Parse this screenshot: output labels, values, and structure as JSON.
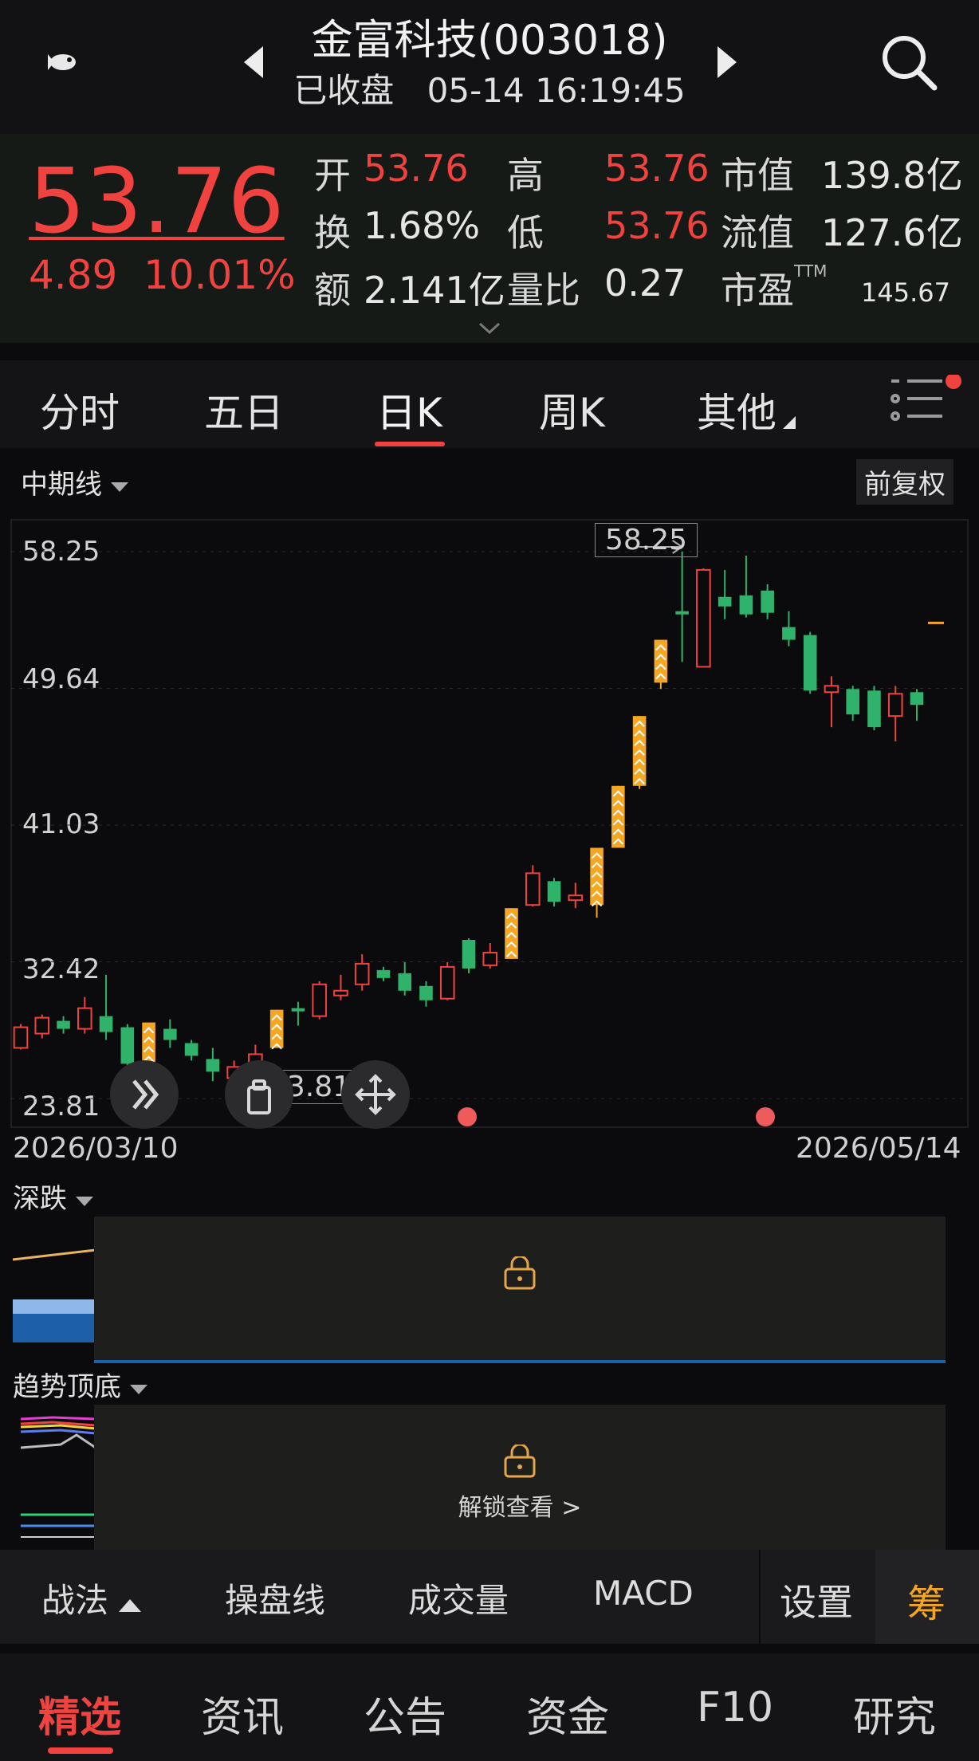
{
  "header": {
    "title": "金富科技(003018)",
    "status": "已收盘",
    "datetime": "05-14 16:19:45",
    "icons": [
      "fish-logo-icon",
      "prev-arrow-icon",
      "next-arrow-icon",
      "search-icon"
    ]
  },
  "quote": {
    "price": "53.76",
    "change": "4.89",
    "change_pct": "10.01%",
    "open_label": "开",
    "open": "53.76",
    "high_label": "高",
    "high": "53.76",
    "mktcap_label": "市值",
    "mktcap": "139.8亿",
    "turnover_label": "换",
    "turnover": "1.68%",
    "low_label": "低",
    "low": "53.76",
    "float_label": "流值",
    "float": "127.6亿",
    "amount_label": "额",
    "amount": "2.141亿",
    "volratio_label": "量比",
    "volratio": "0.27",
    "pe_label": "市盈",
    "pe_sup": "TTM",
    "pe": "145.67"
  },
  "tabs": [
    "分时",
    "五日",
    "日K",
    "周K",
    "其他"
  ],
  "active_tab": "日K",
  "chart_header": {
    "period": "中期线",
    "adjust": "前复权"
  },
  "chart_data": {
    "type": "candlestick",
    "x_start": "2026/03/10",
    "x_end": "2026/05/14",
    "y_ticks": [
      "58.25",
      "49.64",
      "41.03",
      "32.42",
      "23.81"
    ],
    "ylim": [
      23.81,
      58.25
    ],
    "max_label": "58.25",
    "min_label": "23.81",
    "up_color": "#f0433f",
    "down_color": "#2fb36a",
    "limit_up_color": "#f5a623",
    "candles": [
      {
        "o": 27.0,
        "c": 28.3,
        "h": 28.5,
        "l": 26.9
      },
      {
        "o": 27.9,
        "c": 28.9,
        "h": 29.1,
        "l": 27.6
      },
      {
        "o": 28.7,
        "c": 28.2,
        "h": 29.0,
        "l": 27.9
      },
      {
        "o": 28.2,
        "c": 29.5,
        "h": 30.2,
        "l": 27.9
      },
      {
        "o": 29.0,
        "c": 28.0,
        "h": 31.6,
        "l": 27.5
      },
      {
        "o": 28.3,
        "c": 26.0,
        "h": 28.5,
        "l": 25.4
      },
      {
        "o": 26.0,
        "c": 28.6,
        "h": 28.6,
        "l": 26.0,
        "lu": true
      },
      {
        "o": 28.2,
        "c": 27.5,
        "h": 28.8,
        "l": 27.0
      },
      {
        "o": 27.3,
        "c": 26.5,
        "h": 27.5,
        "l": 26.2
      },
      {
        "o": 26.3,
        "c": 25.5,
        "h": 27.0,
        "l": 24.9
      },
      {
        "o": 25.1,
        "c": 25.8,
        "h": 26.2,
        "l": 24.8
      },
      {
        "o": 25.9,
        "c": 26.6,
        "h": 27.2,
        "l": 25.5
      },
      {
        "o": 27.0,
        "c": 29.4,
        "h": 29.4,
        "l": 27.0,
        "lu": true
      },
      {
        "o": 29.5,
        "c": 29.3,
        "h": 29.9,
        "l": 28.4
      },
      {
        "o": 29.0,
        "c": 31.0,
        "h": 31.2,
        "l": 28.8
      },
      {
        "o": 30.3,
        "c": 30.6,
        "h": 31.6,
        "l": 30.0
      },
      {
        "o": 31.0,
        "c": 32.3,
        "h": 32.9,
        "l": 30.6
      },
      {
        "o": 31.9,
        "c": 31.4,
        "h": 32.1,
        "l": 31.2
      },
      {
        "o": 31.7,
        "c": 30.6,
        "h": 32.4,
        "l": 30.3
      },
      {
        "o": 30.9,
        "c": 30.0,
        "h": 31.2,
        "l": 29.6
      },
      {
        "o": 30.1,
        "c": 32.1,
        "h": 32.4,
        "l": 30.0
      },
      {
        "o": 33.8,
        "c": 32.0,
        "h": 33.9,
        "l": 31.7
      },
      {
        "o": 32.2,
        "c": 33.0,
        "h": 33.6,
        "l": 32.0
      },
      {
        "o": 32.6,
        "c": 35.8,
        "h": 35.8,
        "l": 32.6,
        "lu": true
      },
      {
        "o": 36.0,
        "c": 38.0,
        "h": 38.5,
        "l": 35.9
      },
      {
        "o": 37.5,
        "c": 36.2,
        "h": 37.7,
        "l": 35.9
      },
      {
        "o": 36.3,
        "c": 36.6,
        "h": 37.4,
        "l": 35.8
      },
      {
        "o": 36.0,
        "c": 39.6,
        "h": 39.6,
        "l": 35.2,
        "lu": true
      },
      {
        "o": 39.6,
        "c": 43.5,
        "h": 43.5,
        "l": 39.6,
        "lu": true
      },
      {
        "o": 43.5,
        "c": 47.9,
        "h": 47.9,
        "l": 43.3,
        "lu": true
      },
      {
        "o": 50.0,
        "c": 52.7,
        "h": 52.7,
        "l": 49.6,
        "lu": true
      },
      {
        "o": 54.5,
        "c": 54.3,
        "h": 58.25,
        "l": 51.3
      },
      {
        "o": 51.0,
        "c": 57.1,
        "h": 57.2,
        "l": 51.0
      },
      {
        "o": 55.4,
        "c": 54.8,
        "h": 57.1,
        "l": 54.0
      },
      {
        "o": 55.5,
        "c": 54.3,
        "h": 58.0,
        "l": 54.1
      },
      {
        "o": 55.8,
        "c": 54.4,
        "h": 56.2,
        "l": 54.0
      },
      {
        "o": 53.5,
        "c": 52.7,
        "h": 54.5,
        "l": 52.3
      },
      {
        "o": 53.0,
        "c": 49.5,
        "h": 53.2,
        "l": 49.3
      },
      {
        "o": 49.4,
        "c": 49.8,
        "h": 50.4,
        "l": 47.2
      },
      {
        "o": 49.6,
        "c": 48.0,
        "h": 49.8,
        "l": 47.6
      },
      {
        "o": 49.5,
        "c": 47.2,
        "h": 49.8,
        "l": 47.0
      },
      {
        "o": 47.9,
        "c": 49.3,
        "h": 49.8,
        "l": 46.3
      },
      {
        "o": 49.4,
        "c": 48.6,
        "h": 49.6,
        "l": 47.6
      }
    ]
  },
  "sub_panels": [
    {
      "title": "深跌"
    },
    {
      "title": "趋势顶底",
      "unlock": "解锁查看 >"
    }
  ],
  "strategy_bar": {
    "items": [
      "战法",
      "操盘线",
      "成交量",
      "MACD"
    ],
    "settings": "设置",
    "chip": "筹"
  },
  "bottom_nav": {
    "items": [
      "精选",
      "资讯",
      "公告",
      "资金",
      "F10",
      "研究"
    ],
    "active": "精选"
  }
}
